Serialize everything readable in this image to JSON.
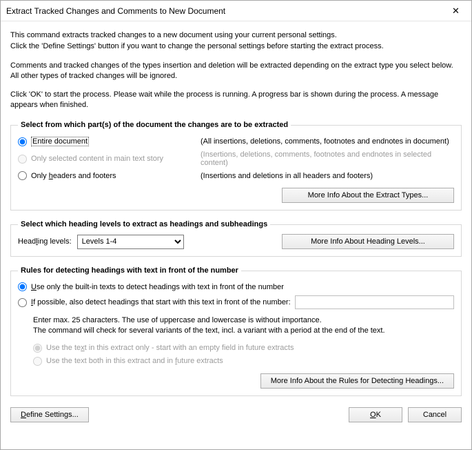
{
  "title": "Extract Tracked Changes and Comments to New Document",
  "intro": {
    "p1": "This command extracts tracked changes to a new document using your current personal settings.",
    "p2": "Click the 'Define Settings' button if you want to change the personal settings before starting the extract process.",
    "p3": "Comments and tracked changes of the types insertion and deletion will be extracted depending on the extract type you select below. All other types of tracked changes will be ignored.",
    "p4": "Click 'OK' to start the process. Please wait while the process is running. A progress bar is shown during the process. A message appears when finished."
  },
  "g1": {
    "legend": "Select from which part(s) of the document the changes are to be extracted",
    "r1_label": "Entire document",
    "r1_desc": "(All insertions, deletions, comments, footnotes and endnotes in document)",
    "r2_label": "Only selected content in main text story",
    "r2_desc": "(Insertions, deletions, comments, footnotes and endnotes in selected content)",
    "r3_label_pre": "Only ",
    "r3_label_u": "h",
    "r3_label_post": "eaders and footers",
    "r3_desc": "(Insertions and deletions in all headers and footers)",
    "more_btn": "More Info About the Extract Types..."
  },
  "g2": {
    "legend": "Select which heading levels to extract as headings and subheadings",
    "label_pre": "Head",
    "label_u": "l",
    "label_post": "ing levels:",
    "selected": "Levels 1-4",
    "more_btn": "More Info About Heading Levels..."
  },
  "g3": {
    "legend": "Rules for detecting headings with text in front of the number",
    "r1_pre": "",
    "r1_u": "U",
    "r1_post": "se only the built-in texts to detect headings with text in front of the number",
    "r2_u": "I",
    "r2_post": "f possible, also detect headings that start with this text in front of the number:",
    "explain1": "Enter max. 25 characters. The use of uppercase and lowercase is without importance.",
    "explain2": "The command will check for several variants of the text, incl. a variant with a period at the end of the text.",
    "sr1_pre": "Use the te",
    "sr1_u": "x",
    "sr1_post": "t in this extract only - start with an empty field in future extracts",
    "sr2_pre": "Use the text both in this extract and in ",
    "sr2_u": "f",
    "sr2_post": "uture extracts",
    "more_btn": "More Info About the Rules for Detecting Headings...",
    "text_value": ""
  },
  "footer": {
    "define_pre": "",
    "define_u": "D",
    "define_post": "efine Settings...",
    "ok_u": "O",
    "ok_post": "K",
    "cancel": "Cancel"
  }
}
